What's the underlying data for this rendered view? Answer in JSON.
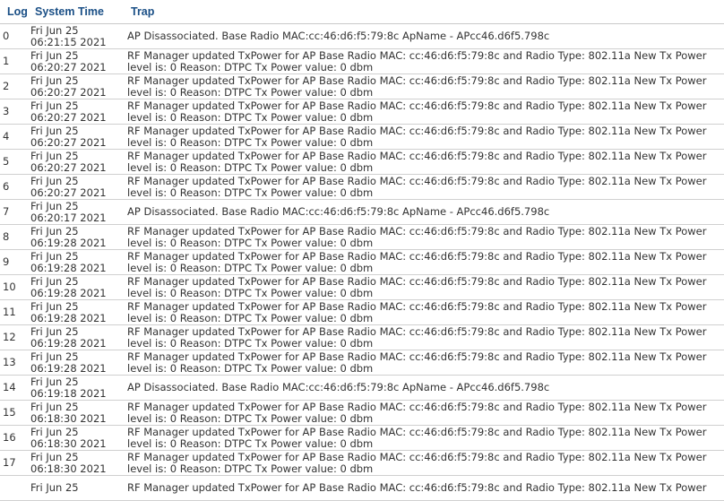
{
  "table": {
    "headers": {
      "log": "Log",
      "time": "System Time",
      "trap": "Trap"
    },
    "rows": [
      {
        "log": "0",
        "day": "Fri Jun 25",
        "clock": "06:21:15 2021",
        "trap": "AP Disassociated. Base Radio MAC:cc:46:d6:f5:79:8c ApName - APcc46.d6f5.798c"
      },
      {
        "log": "1",
        "day": "Fri Jun 25",
        "clock": "06:20:27 2021",
        "trap": "RF Manager updated TxPower for AP Base Radio MAC: cc:46:d6:f5:79:8c and Radio Type: 802.11a New Tx Power level is: 0 Reason: DTPC Tx Power value: 0 dbm"
      },
      {
        "log": "2",
        "day": "Fri Jun 25",
        "clock": "06:20:27 2021",
        "trap": "RF Manager updated TxPower for AP Base Radio MAC: cc:46:d6:f5:79:8c and Radio Type: 802.11a New Tx Power level is: 0 Reason: DTPC Tx Power value: 0 dbm"
      },
      {
        "log": "3",
        "day": "Fri Jun 25",
        "clock": "06:20:27 2021",
        "trap": "RF Manager updated TxPower for AP Base Radio MAC: cc:46:d6:f5:79:8c and Radio Type: 802.11a New Tx Power level is: 0 Reason: DTPC Tx Power value: 0 dbm"
      },
      {
        "log": "4",
        "day": "Fri Jun 25",
        "clock": "06:20:27 2021",
        "trap": "RF Manager updated TxPower for AP Base Radio MAC: cc:46:d6:f5:79:8c and Radio Type: 802.11a New Tx Power level is: 0 Reason: DTPC Tx Power value: 0 dbm"
      },
      {
        "log": "5",
        "day": "Fri Jun 25",
        "clock": "06:20:27 2021",
        "trap": "RF Manager updated TxPower for AP Base Radio MAC: cc:46:d6:f5:79:8c and Radio Type: 802.11a New Tx Power level is: 0 Reason: DTPC Tx Power value: 0 dbm"
      },
      {
        "log": "6",
        "day": "Fri Jun 25",
        "clock": "06:20:27 2021",
        "trap": "RF Manager updated TxPower for AP Base Radio MAC: cc:46:d6:f5:79:8c and Radio Type: 802.11a New Tx Power level is: 0 Reason: DTPC Tx Power value: 0 dbm"
      },
      {
        "log": "7",
        "day": "Fri Jun 25",
        "clock": "06:20:17 2021",
        "trap": "AP Disassociated. Base Radio MAC:cc:46:d6:f5:79:8c ApName - APcc46.d6f5.798c"
      },
      {
        "log": "8",
        "day": "Fri Jun 25",
        "clock": "06:19:28 2021",
        "trap": "RF Manager updated TxPower for AP Base Radio MAC: cc:46:d6:f5:79:8c and Radio Type: 802.11a New Tx Power level is: 0 Reason: DTPC Tx Power value: 0 dbm"
      },
      {
        "log": "9",
        "day": "Fri Jun 25",
        "clock": "06:19:28 2021",
        "trap": "RF Manager updated TxPower for AP Base Radio MAC: cc:46:d6:f5:79:8c and Radio Type: 802.11a New Tx Power level is: 0 Reason: DTPC Tx Power value: 0 dbm"
      },
      {
        "log": "10",
        "day": "Fri Jun 25",
        "clock": "06:19:28 2021",
        "trap": "RF Manager updated TxPower for AP Base Radio MAC: cc:46:d6:f5:79:8c and Radio Type: 802.11a New Tx Power level is: 0 Reason: DTPC Tx Power value: 0 dbm"
      },
      {
        "log": "11",
        "day": "Fri Jun 25",
        "clock": "06:19:28 2021",
        "trap": "RF Manager updated TxPower for AP Base Radio MAC: cc:46:d6:f5:79:8c and Radio Type: 802.11a New Tx Power level is: 0 Reason: DTPC Tx Power value: 0 dbm"
      },
      {
        "log": "12",
        "day": "Fri Jun 25",
        "clock": "06:19:28 2021",
        "trap": "RF Manager updated TxPower for AP Base Radio MAC: cc:46:d6:f5:79:8c and Radio Type: 802.11a New Tx Power level is: 0 Reason: DTPC Tx Power value: 0 dbm"
      },
      {
        "log": "13",
        "day": "Fri Jun 25",
        "clock": "06:19:28 2021",
        "trap": "RF Manager updated TxPower for AP Base Radio MAC: cc:46:d6:f5:79:8c and Radio Type: 802.11a New Tx Power level is: 0 Reason: DTPC Tx Power value: 0 dbm"
      },
      {
        "log": "14",
        "day": "Fri Jun 25",
        "clock": "06:19:18 2021",
        "trap": "AP Disassociated. Base Radio MAC:cc:46:d6:f5:79:8c ApName - APcc46.d6f5.798c"
      },
      {
        "log": "15",
        "day": "Fri Jun 25",
        "clock": "06:18:30 2021",
        "trap": "RF Manager updated TxPower for AP Base Radio MAC: cc:46:d6:f5:79:8c and Radio Type: 802.11a New Tx Power level is: 0 Reason: DTPC Tx Power value: 0 dbm"
      },
      {
        "log": "16",
        "day": "Fri Jun 25",
        "clock": "06:18:30 2021",
        "trap": "RF Manager updated TxPower for AP Base Radio MAC: cc:46:d6:f5:79:8c and Radio Type: 802.11a New Tx Power level is: 0 Reason: DTPC Tx Power value: 0 dbm"
      },
      {
        "log": "17",
        "day": "Fri Jun 25",
        "clock": "06:18:30 2021",
        "trap": "RF Manager updated TxPower for AP Base Radio MAC: cc:46:d6:f5:79:8c and Radio Type: 802.11a New Tx Power level is: 0 Reason: DTPC Tx Power value: 0 dbm"
      },
      {
        "log": "",
        "day": "Fri Jun 25",
        "clock": "",
        "trap": "RF Manager updated TxPower for AP Base Radio MAC: cc:46:d6:f5:79:8c and Radio Type: 802.11a New Tx Power"
      }
    ]
  }
}
